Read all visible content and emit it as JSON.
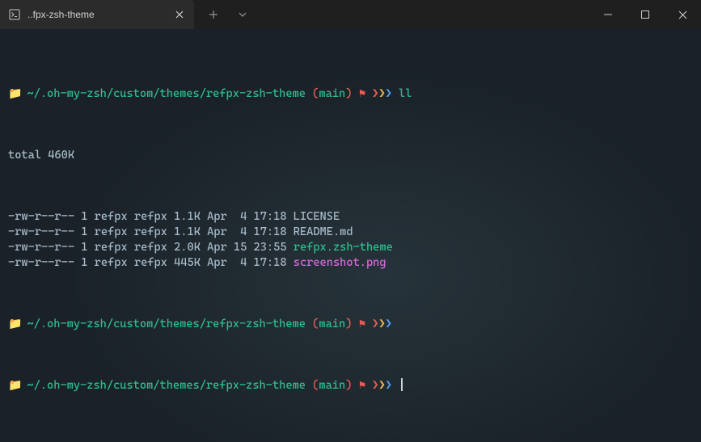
{
  "titlebar": {
    "tab_title": "..fpx-zsh-theme"
  },
  "terminal": {
    "path": "~/.oh-my-zsh/custom/themes/refpx-zsh-theme",
    "branch": "main",
    "arrows": {
      "a1": "❯",
      "a2": "❯",
      "a3": "❯"
    },
    "flag": "⚑",
    "cmd1": "ll",
    "total": "total 460K",
    "rows": [
      {
        "perm": "-rw-r--r-- 1 refpx refpx 1.1K Apr  4 17:18 ",
        "name": "LICENSE",
        "cls": "plain"
      },
      {
        "perm": "-rw-r--r-- 1 refpx refpx 1.1K Apr  4 17:18 ",
        "name": "README.md",
        "cls": "plain"
      },
      {
        "perm": "-rw-r--r-- 1 refpx refpx 2.0K Apr 15 23:55 ",
        "name": "refpx.zsh-theme",
        "cls": "exe"
      },
      {
        "perm": "-rw-r--r-- 1 refpx refpx 445K Apr  4 17:18 ",
        "name": "screenshot.png",
        "cls": "img"
      }
    ]
  }
}
